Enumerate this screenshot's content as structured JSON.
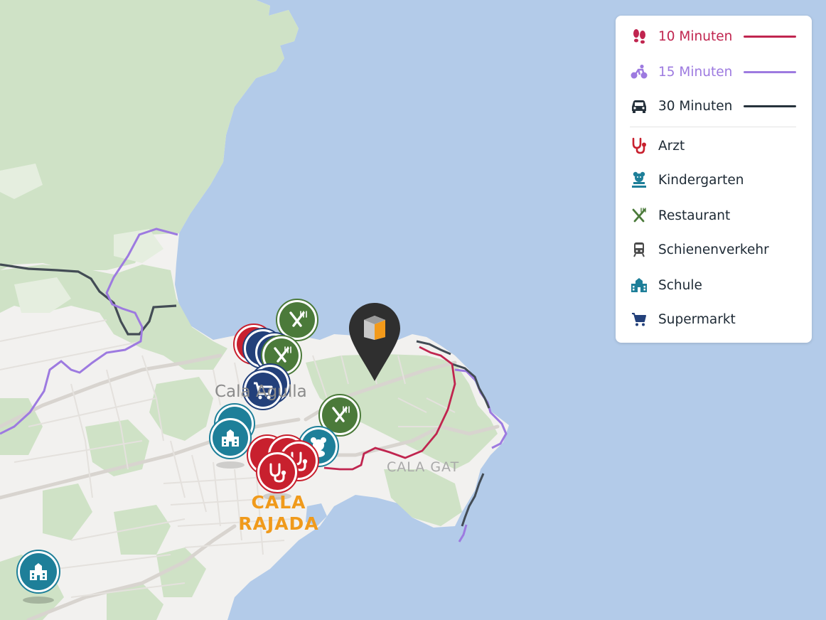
{
  "map": {
    "place_labels": {
      "cala_agulla": "Cala Agulla",
      "cala_gat": "CALA GAT",
      "cala_rajada_line1": "CALA",
      "cala_rajada_line2": "RAJADA"
    }
  },
  "legend": {
    "travel": [
      {
        "label": "10 Minuten",
        "icon": "footprints-icon",
        "color": "#c0254f"
      },
      {
        "label": "15 Minuten",
        "icon": "bicycle-icon",
        "color": "#9d7ae0"
      },
      {
        "label": "30 Minuten",
        "icon": "car-icon",
        "color": "#26323c"
      }
    ],
    "poi": [
      {
        "label": "Arzt",
        "icon": "stethoscope-icon",
        "color": "#c8202e"
      },
      {
        "label": "Kindergarten",
        "icon": "teddy-bear-icon",
        "color": "#1e7f99"
      },
      {
        "label": "Restaurant",
        "icon": "fork-knife-icon",
        "color": "#4b7a3a"
      },
      {
        "label": "Schienenverkehr",
        "icon": "train-icon",
        "color": "#4a4a4a"
      },
      {
        "label": "Schule",
        "icon": "school-icon",
        "color": "#1e7f99"
      },
      {
        "label": "Supermarkt",
        "icon": "cart-icon",
        "color": "#23407a"
      }
    ]
  }
}
